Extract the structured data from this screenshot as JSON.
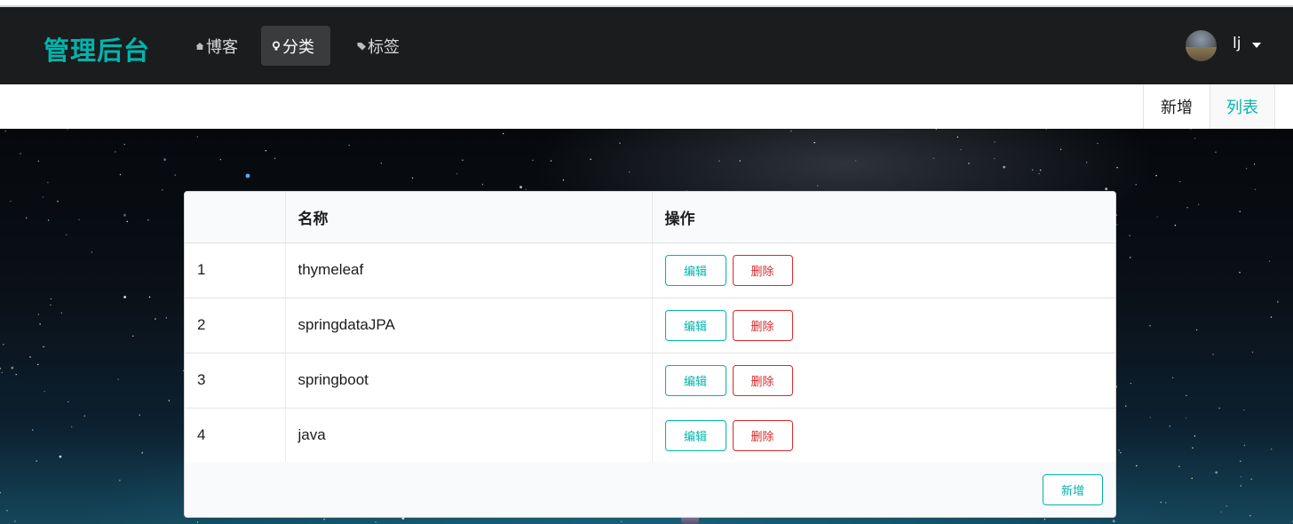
{
  "navbar": {
    "brand": "管理后台",
    "items": [
      {
        "label": "博客",
        "icon": "home-icon"
      },
      {
        "label": "分类",
        "icon": "idea-icon",
        "active": true
      },
      {
        "label": "标签",
        "icon": "tags-icon"
      }
    ],
    "user": {
      "name": "lj",
      "avatar": "avatar-image"
    }
  },
  "submenu": {
    "new_label": "新增",
    "list_label": "列表"
  },
  "table": {
    "headers": [
      "",
      "名称",
      "操作"
    ],
    "rows": [
      {
        "index": "1",
        "name": "thymeleaf",
        "edit": "编辑",
        "delete": "删除"
      },
      {
        "index": "2",
        "name": "springdataJPA",
        "edit": "编辑",
        "delete": "删除"
      },
      {
        "index": "3",
        "name": "springboot",
        "edit": "编辑",
        "delete": "删除"
      },
      {
        "index": "4",
        "name": "java",
        "edit": "编辑",
        "delete": "删除"
      }
    ],
    "footer_add_label": "新增"
  },
  "colors": {
    "accent": "#00b5ad",
    "danger": "#db2828",
    "navbar_bg": "#1b1c1d"
  }
}
